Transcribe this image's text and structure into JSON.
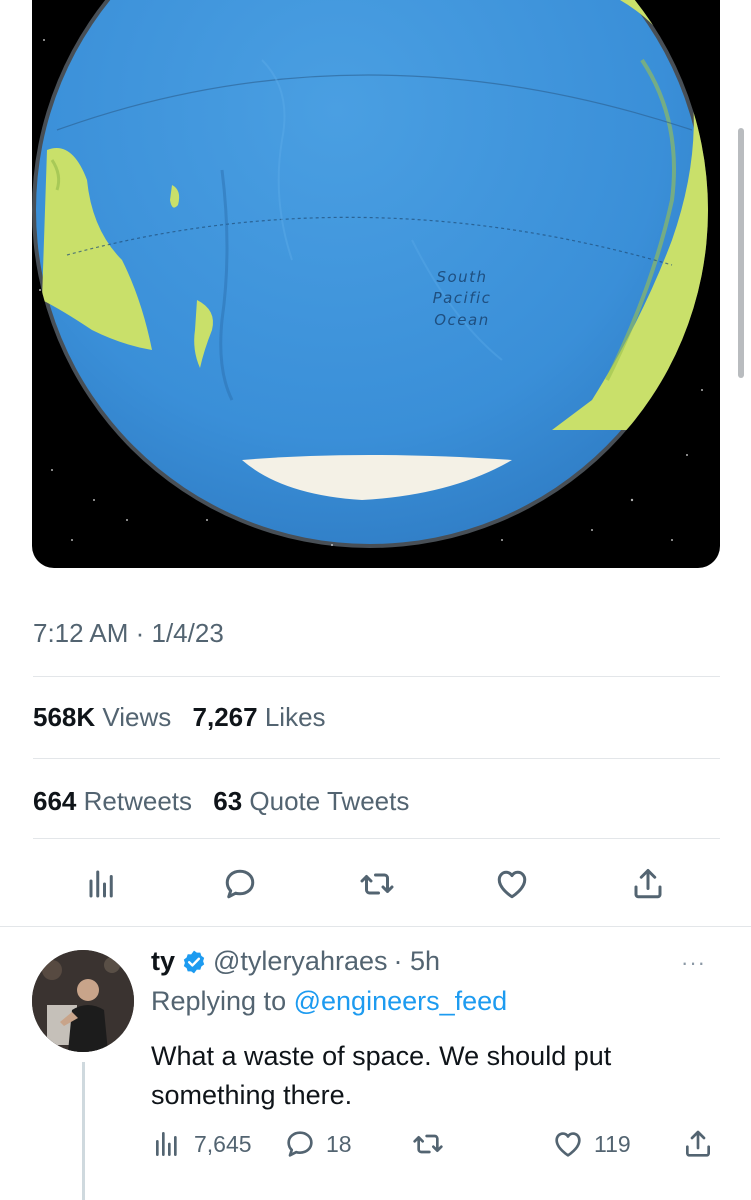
{
  "media": {
    "ocean_label_lines": [
      "South",
      "Pacific",
      "Ocean"
    ],
    "colors": {
      "space": "#000000",
      "ocean": "#3d8fd6",
      "land": "#c9e06a",
      "ice": "#f4f1e6"
    }
  },
  "tweet": {
    "timestamp": "7:12 AM · 1/4/23",
    "views_count": "568K",
    "views_label": "Views",
    "likes_count": "7,267",
    "likes_label": "Likes",
    "retweets_count": "664",
    "retweets_label": "Retweets",
    "quotes_count": "63",
    "quotes_label": "Quote Tweets",
    "actions": [
      "analytics-icon",
      "reply-icon",
      "retweet-icon",
      "like-icon",
      "share-icon"
    ]
  },
  "reply": {
    "name": "ty",
    "handle": "@tyleryahraes",
    "time": "· 5h",
    "replying_prefix": "Replying to",
    "replying_to": "@engineers_feed",
    "text": "What a waste of space. We should put something there.",
    "more": "···",
    "views": "7,645",
    "replies": "18",
    "retweets": "",
    "likes": "119"
  },
  "colors": {
    "accent": "#1d9bf0",
    "muted": "#536471",
    "text": "#0f1419"
  }
}
